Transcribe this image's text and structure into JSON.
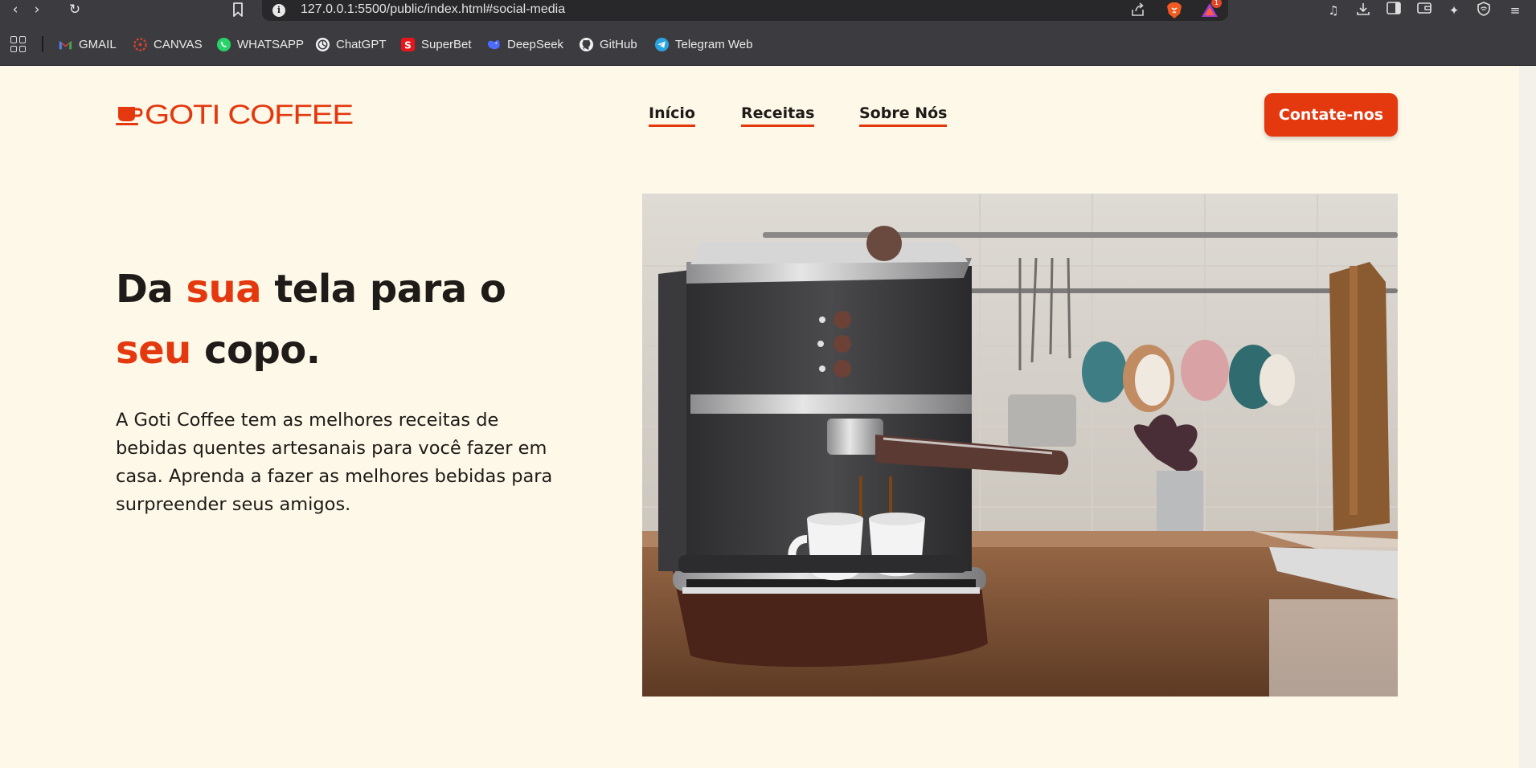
{
  "browser": {
    "url": "127.0.0.1:5500/public/index.html#social-media",
    "rewards_badge": "1",
    "icons": {
      "back": "back-arrow-icon",
      "forward": "forward-arrow-icon",
      "reload": "reload-icon",
      "bookmark": "bookmark-icon",
      "info": "info-icon",
      "share": "share-icon",
      "brave": "brave-shields-icon",
      "rewards": "brave-rewards-icon",
      "media": "media-icon",
      "downloads": "download-icon",
      "sidebar": "sidebar-icon",
      "wallet": "wallet-icon",
      "leo": "leo-ai-icon",
      "vpn": "vpn-icon",
      "menu": "menu-icon"
    }
  },
  "bookmarks": [
    {
      "label": "GMAIL",
      "icon": "gmail-icon"
    },
    {
      "label": "CANVAS",
      "icon": "canvas-icon"
    },
    {
      "label": "WHATSAPP",
      "icon": "whatsapp-icon"
    },
    {
      "label": "ChatGPT",
      "icon": "chatgpt-icon"
    },
    {
      "label": "SuperBet",
      "icon": "superbet-icon"
    },
    {
      "label": "DeepSeek",
      "icon": "deepseek-icon"
    },
    {
      "label": "GitHub",
      "icon": "github-icon"
    },
    {
      "label": "Telegram Web",
      "icon": "telegram-icon"
    }
  ],
  "site": {
    "brand": "GOTI COFFEE",
    "accent_color": "#e4380e",
    "background_color": "#fef8e8",
    "text_color": "#1e1b18",
    "nav": [
      {
        "label": "Início"
      },
      {
        "label": "Receitas"
      },
      {
        "label": "Sobre Nós"
      }
    ],
    "cta": "Contate-nos",
    "hero": {
      "headline": {
        "w1": "Da",
        "w2": "sua",
        "w3": "tela para o",
        "w4": "seu",
        "w5": "copo."
      },
      "description": "A Goti Coffee tem as melhores receitas de bebidas quentes artesanais para você fazer em casa. Aprenda a fazer as melhores bebidas para surpreender seus amigos."
    }
  }
}
